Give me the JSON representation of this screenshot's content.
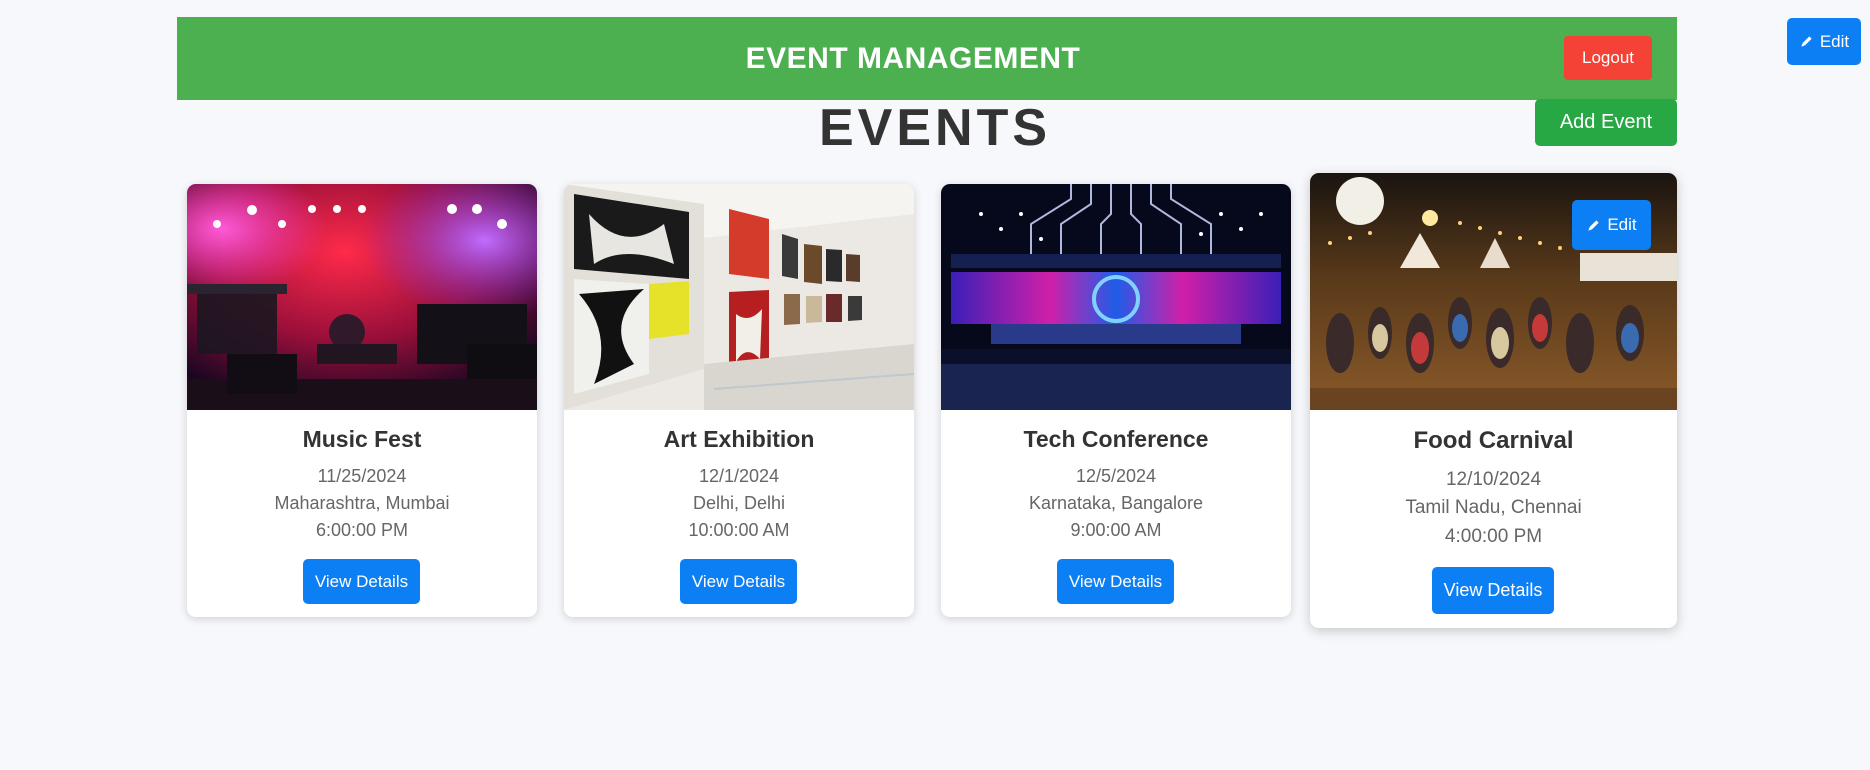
{
  "header": {
    "title": "EVENT MANAGEMENT",
    "logout_label": "Logout"
  },
  "top_edit": {
    "label": "Edit",
    "icon": "pencil-icon"
  },
  "page": {
    "title": "EVENTS",
    "add_label": "Add Event"
  },
  "events": [
    {
      "name": "Music Fest",
      "date": "11/25/2024",
      "location": "Maharashtra, Mumbai",
      "time": "6:00:00 PM",
      "button": "View Details"
    },
    {
      "name": "Art Exhibition",
      "date": "12/1/2024",
      "location": "Delhi, Delhi",
      "time": "10:00:00 AM",
      "button": "View Details"
    },
    {
      "name": "Tech Conference",
      "date": "12/5/2024",
      "location": "Karnataka, Bangalore",
      "time": "9:00:00 AM",
      "button": "View Details"
    },
    {
      "name": "Food Carnival",
      "date": "12/10/2024",
      "location": "Tamil Nadu, Chennai",
      "time": "4:00:00 PM",
      "button": "View Details",
      "edit_label": "Edit"
    }
  ],
  "colors": {
    "header": "#4caf50",
    "logout": "#f44336",
    "add": "#28a745",
    "primary": "#0d7ff5",
    "background": "#f7f8fc"
  }
}
